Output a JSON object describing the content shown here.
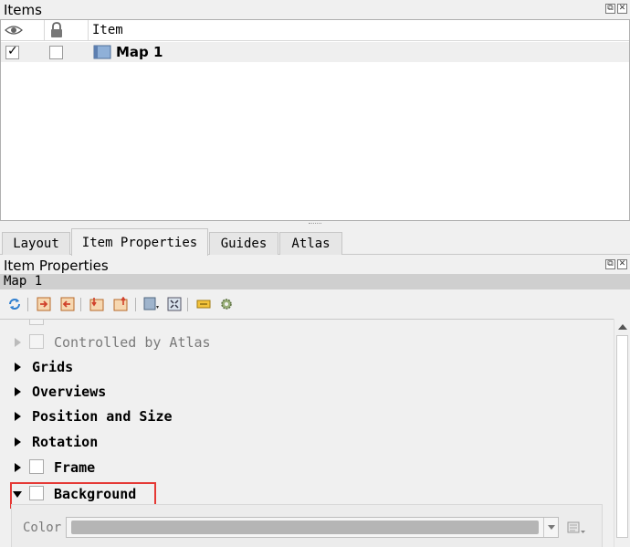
{
  "items_panel": {
    "title": "Items",
    "float_icon": "⧉",
    "close_icon": "✕",
    "columns": {
      "visible": "eye-icon",
      "locked": "lock-icon",
      "item": "Item"
    },
    "rows": [
      {
        "label": "Map 1",
        "visible": true,
        "locked": false,
        "icon": "map-icon"
      }
    ]
  },
  "tabs": [
    {
      "label": "Layout",
      "active": false
    },
    {
      "label": "Item Properties",
      "active": true
    },
    {
      "label": "Guides",
      "active": false
    },
    {
      "label": "Atlas",
      "active": false
    }
  ],
  "item_properties": {
    "title": "Item Properties",
    "float_icon": "⧉",
    "close_icon": "✕",
    "item_name": "Map 1",
    "toolbar_icons": [
      "refresh-icon",
      "set-extent-icon",
      "view-extent-icon",
      "move-content-icon",
      "link-icon",
      "bookmarks-icon",
      "zoom-icon",
      "labels-icon",
      "settings-icon"
    ],
    "sections": [
      {
        "label": "Controlled by Atlas",
        "enabled": false,
        "has_checkbox": true
      },
      {
        "label": "Grids",
        "enabled": true,
        "has_checkbox": false
      },
      {
        "label": "Overviews",
        "enabled": true,
        "has_checkbox": false
      },
      {
        "label": "Position and Size",
        "enabled": true,
        "has_checkbox": false
      },
      {
        "label": "Rotation",
        "enabled": true,
        "has_checkbox": false
      },
      {
        "label": "Frame",
        "enabled": true,
        "has_checkbox": true
      },
      {
        "label": "Background",
        "enabled": true,
        "has_checkbox": true,
        "expanded": true
      }
    ],
    "background": {
      "color_label": "Color",
      "color_value": "#b5b5b5"
    }
  },
  "colors": {
    "highlight": "#e53935",
    "map_icon": "#6a8fc0"
  }
}
